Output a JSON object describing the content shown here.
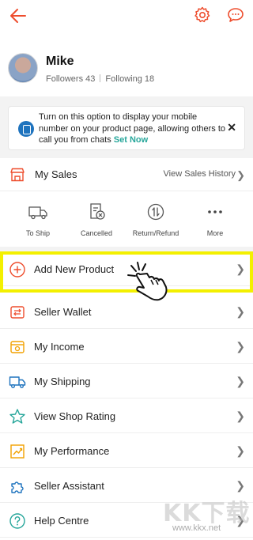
{
  "colors": {
    "accent": "#ee4d2d",
    "highlight": "#f3f000",
    "teal": "#26a69a"
  },
  "header": {
    "back_icon": "arrow-left-icon",
    "settings_icon": "gear-icon",
    "chat_icon": "chat-bubble-icon"
  },
  "profile": {
    "name": "Mike",
    "followers": "Followers 43",
    "following": "Following 18"
  },
  "notice": {
    "text": "Turn on this option to display your mobile number on your product page, allowing others to call you from chats",
    "link": "Set Now",
    "close": "✕"
  },
  "sales": {
    "label": "My Sales",
    "history": "View Sales History",
    "statuses": [
      {
        "label": "To Ship",
        "icon": "truck-icon"
      },
      {
        "label": "Cancelled",
        "icon": "cancelled-doc-icon"
      },
      {
        "label": "Return/Refund",
        "icon": "return-refund-icon"
      },
      {
        "label": "More",
        "icon": "more-dots-icon"
      }
    ]
  },
  "menu": [
    {
      "label": "Add New Product",
      "icon": "plus-circle-icon"
    },
    {
      "label": "Seller Wallet",
      "icon": "wallet-icon"
    },
    {
      "label": "My Income",
      "icon": "income-icon"
    },
    {
      "label": "My Shipping",
      "icon": "truck-icon"
    },
    {
      "label": "View Shop Rating",
      "icon": "star-icon"
    },
    {
      "label": "My Performance",
      "icon": "chart-icon"
    },
    {
      "label": "Seller Assistant",
      "icon": "puzzle-icon"
    },
    {
      "label": "Help Centre",
      "icon": "help-icon"
    }
  ],
  "watermark": {
    "big": "KK下载",
    "small": "www.kkx.net"
  }
}
